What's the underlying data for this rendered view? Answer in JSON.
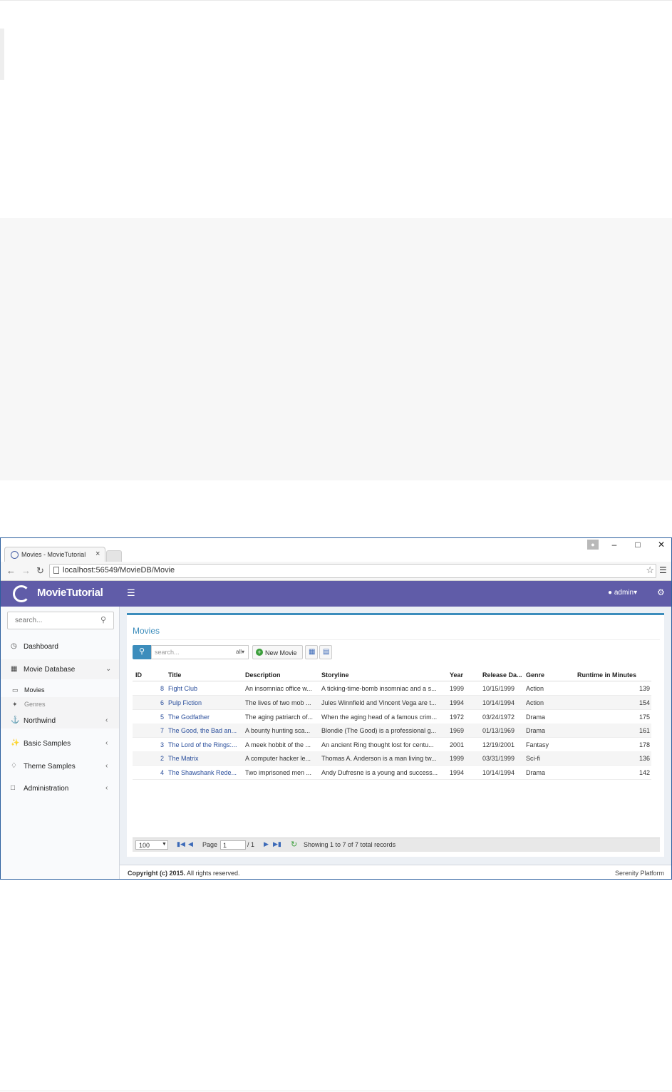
{
  "browser": {
    "tab_title": "Movies - MovieTutorial",
    "tab_close": "×",
    "url": "localhost:56549/MovieDB/Movie"
  },
  "header": {
    "logo_text": "MovieTutorial",
    "user": "admin"
  },
  "sidebar": {
    "search_placeholder": "search...",
    "items": [
      {
        "label": "Dashboard"
      },
      {
        "label": "Movie Database"
      },
      {
        "label": "Northwind"
      },
      {
        "label": "Basic Samples"
      },
      {
        "label": "Theme Samples"
      },
      {
        "label": "Administration"
      }
    ],
    "sub_items": [
      {
        "label": "Movies"
      },
      {
        "label": "Genres"
      }
    ]
  },
  "page": {
    "title": "Movies",
    "search_placeholder": "search...",
    "search_scope": "all",
    "new_button": "New Movie"
  },
  "grid": {
    "columns": [
      "ID",
      "Title",
      "Description",
      "Storyline",
      "Year",
      "Release Da...",
      "Genre",
      "Runtime in Minutes"
    ],
    "rows": [
      {
        "id": "8",
        "title": "Fight Club",
        "description": "An insomniac office w...",
        "storyline": "A ticking-time-bomb insomniac and a s...",
        "year": "1999",
        "release": "10/15/1999",
        "genre": "Action",
        "runtime": "139"
      },
      {
        "id": "6",
        "title": "Pulp Fiction",
        "description": "The lives of two mob ...",
        "storyline": "Jules Winnfield and Vincent Vega are t...",
        "year": "1994",
        "release": "10/14/1994",
        "genre": "Action",
        "runtime": "154"
      },
      {
        "id": "5",
        "title": "The Godfather",
        "description": "The aging patriarch of...",
        "storyline": "When the aging head of a famous crim...",
        "year": "1972",
        "release": "03/24/1972",
        "genre": "Drama",
        "runtime": "175"
      },
      {
        "id": "7",
        "title": "The Good, the Bad an...",
        "description": "A bounty hunting sca...",
        "storyline": "Blondie (The Good) is a professional g...",
        "year": "1969",
        "release": "01/13/1969",
        "genre": "Drama",
        "runtime": "161"
      },
      {
        "id": "3",
        "title": "The Lord of the Rings:...",
        "description": "A meek hobbit of the ...",
        "storyline": "An ancient Ring thought lost for centu...",
        "year": "2001",
        "release": "12/19/2001",
        "genre": "Fantasy",
        "runtime": "178"
      },
      {
        "id": "2",
        "title": "The Matrix",
        "description": "A computer hacker le...",
        "storyline": "Thomas A. Anderson is a man living tw...",
        "year": "1999",
        "release": "03/31/1999",
        "genre": "Sci-fi",
        "runtime": "136"
      },
      {
        "id": "4",
        "title": "The Shawshank Rede...",
        "description": "Two imprisoned men ...",
        "storyline": "Andy Dufresne is a young and success...",
        "year": "1994",
        "release": "10/14/1994",
        "genre": "Drama",
        "runtime": "142"
      }
    ]
  },
  "pager": {
    "page_size": "100",
    "page_label": "Page",
    "page_value": "1",
    "page_total": "/ 1",
    "status": "Showing 1 to 7 of 7 total records"
  },
  "footer": {
    "copyright_bold": "Copyright (c) 2015.",
    "copyright_rest": " All rights reserved.",
    "platform": "Serenity Platform"
  }
}
